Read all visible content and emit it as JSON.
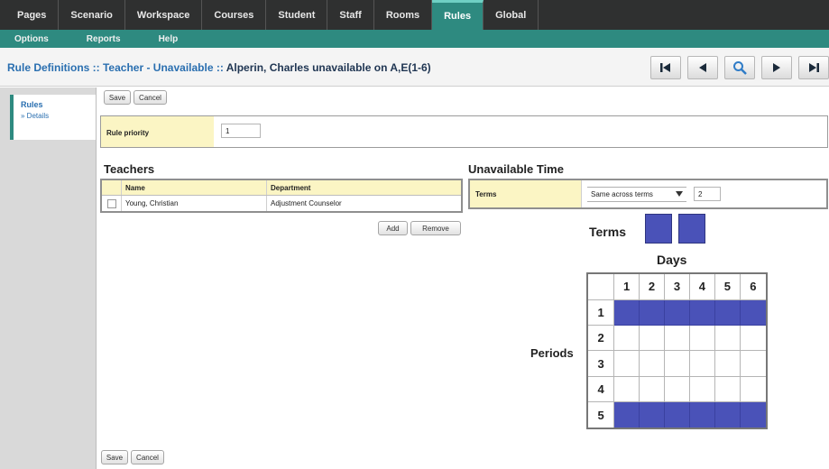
{
  "top_nav": [
    "Pages",
    "Scenario",
    "Workspace",
    "Courses",
    "Student",
    "Staff",
    "Rooms",
    "Rules",
    "Global"
  ],
  "active_top_nav": "Rules",
  "sub_nav": [
    "Options",
    "Reports",
    "Help"
  ],
  "title": {
    "crumb": "Rule Definitions :: Teacher - Unavailable ::",
    "tail": "Alperin, Charles unavailable on A,E(1-6)"
  },
  "record_nav": [
    "first-record",
    "previous-record",
    "search",
    "next-record",
    "last-record"
  ],
  "sidebar": {
    "section": "Rules",
    "item": "» Details"
  },
  "buttons": {
    "save_top": "Save",
    "cancel_top": "Cancel",
    "add": "Add",
    "remove": "Remove",
    "save_bottom": "Save",
    "cancel_bottom": "Cancel"
  },
  "rule_priority": {
    "label": "Rule priority",
    "value": "1"
  },
  "teachers": {
    "heading": "Teachers",
    "columns": [
      "Name",
      "Department"
    ],
    "rows": [
      {
        "name": "Young, Christian",
        "department": "Adjustment Counselor"
      }
    ]
  },
  "unavailable_time": {
    "heading": "Unavailable Time",
    "label": "Terms",
    "select_value": "Same across terms",
    "count": "2"
  },
  "terms_label": "Terms",
  "term_blocks": [
    true,
    true
  ],
  "days_label": "Days",
  "periods_label": "Periods",
  "days": [
    "1",
    "2",
    "3",
    "4",
    "5",
    "6"
  ],
  "periods": [
    "1",
    "2",
    "3",
    "4",
    "5"
  ],
  "unavailable_periods": [
    "1",
    "5"
  ],
  "colors": {
    "nav_dark": "#2f3030",
    "accent_teal": "#2e8a80",
    "title_blue": "#2a6fb0",
    "cell_fill": "#4a52b8",
    "label_yellow": "#fbf5c4"
  }
}
